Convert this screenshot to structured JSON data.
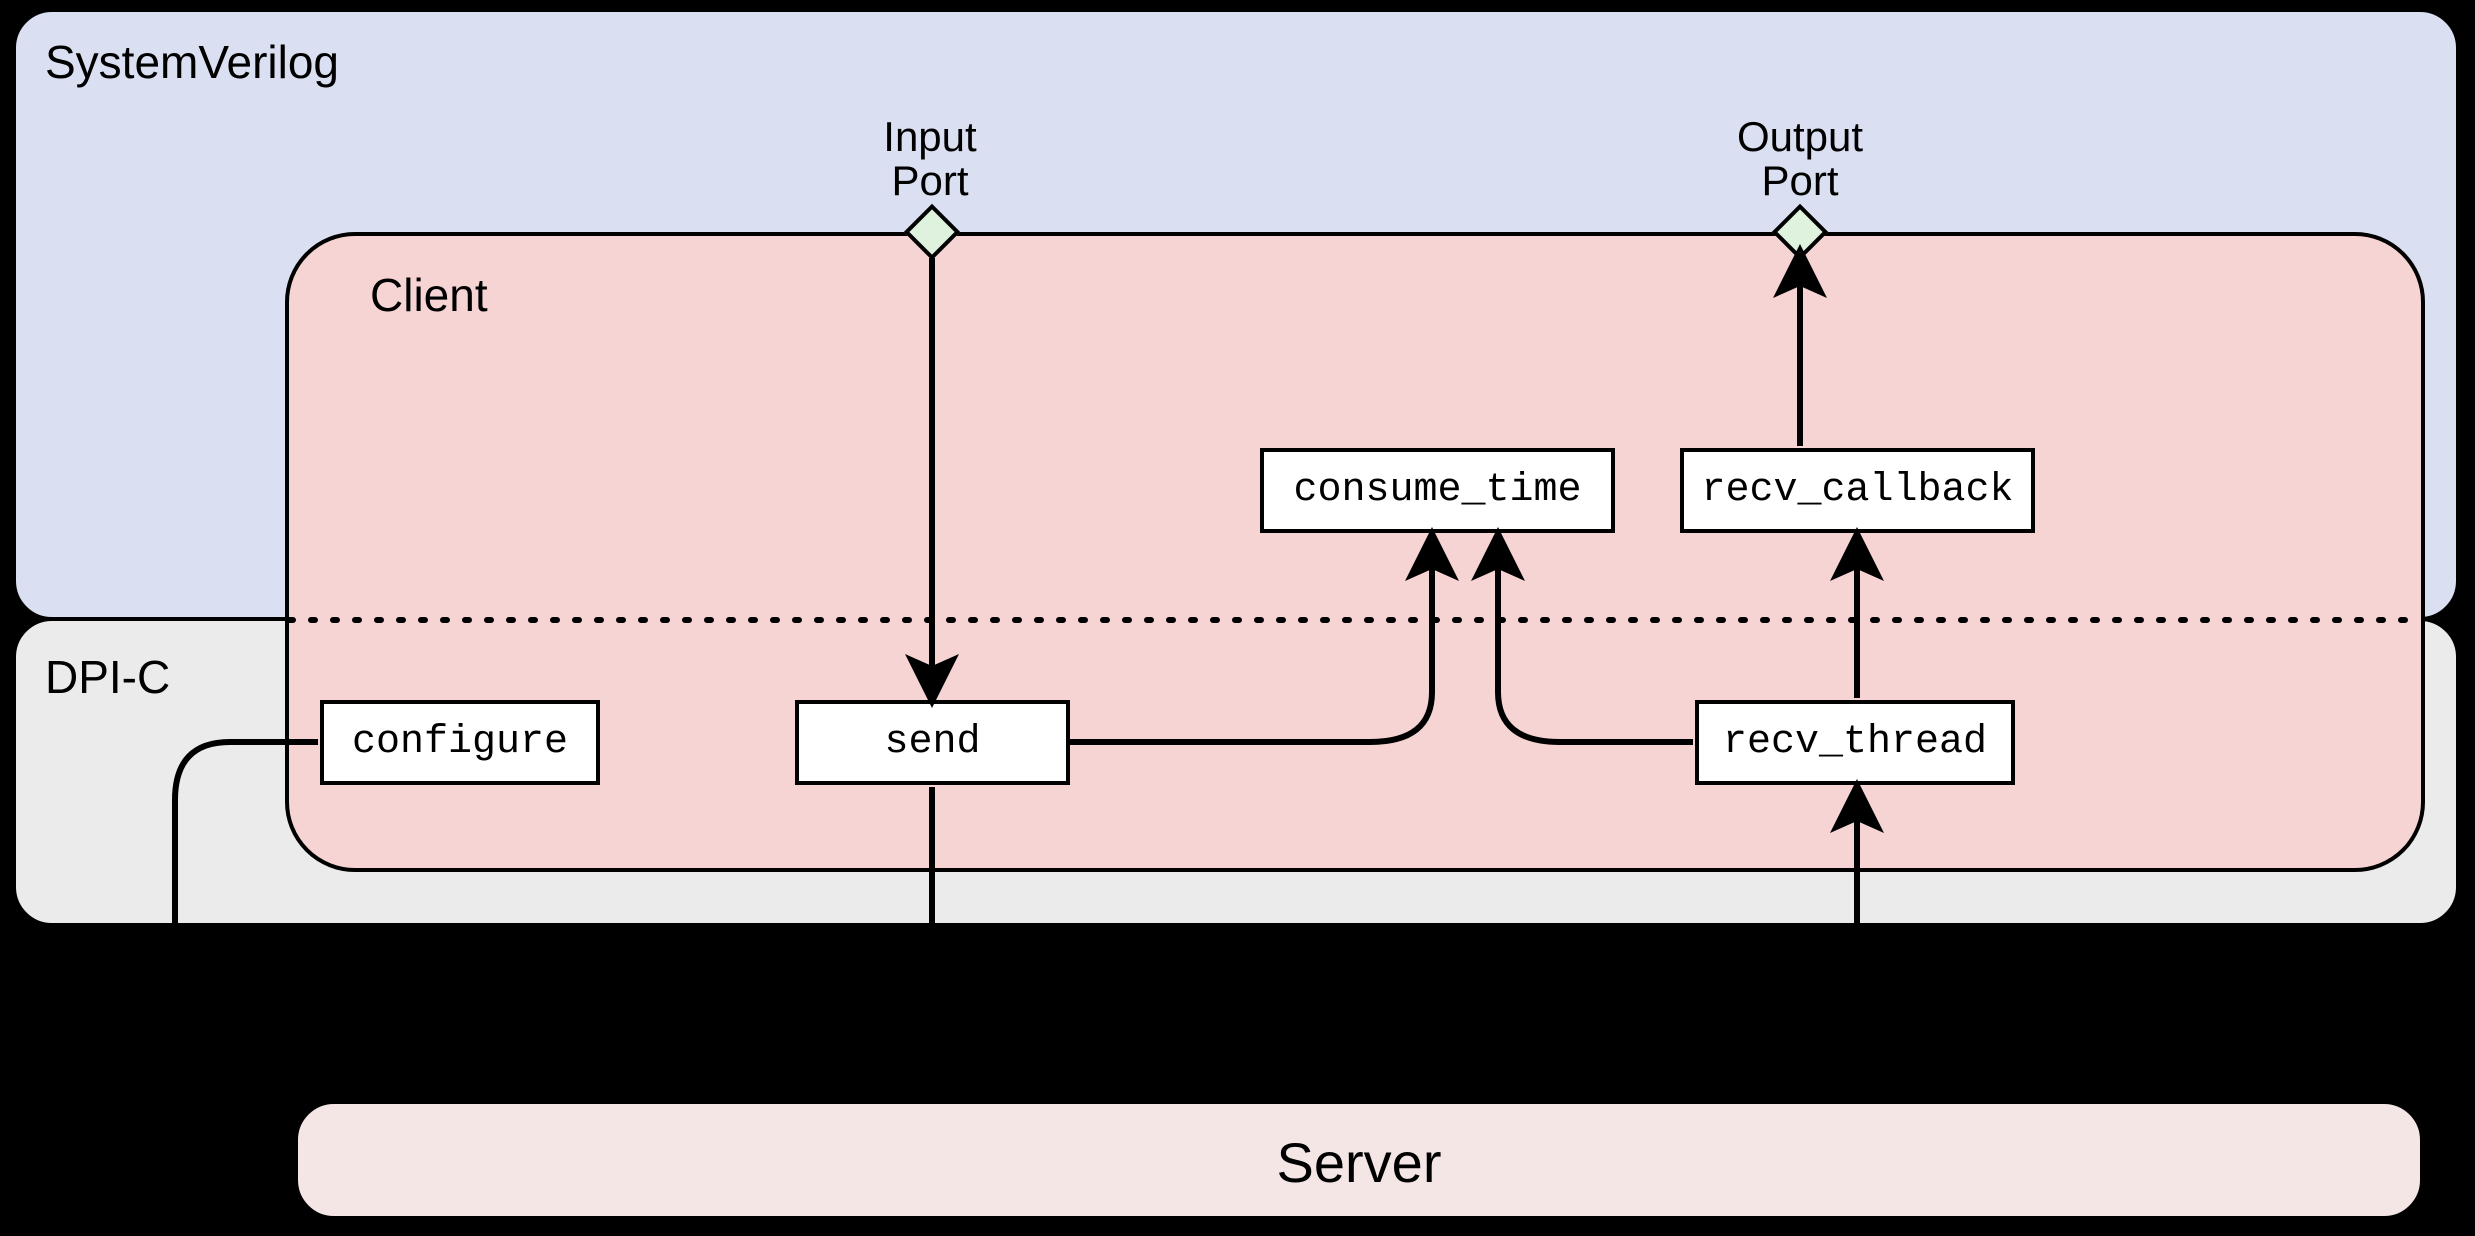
{
  "regions": {
    "systemverilog": "SystemVerilog",
    "dpic": "DPI-C",
    "client": "Client",
    "server": "Server"
  },
  "ports": {
    "input": "Input\nPort",
    "output": "Output\nPort"
  },
  "nodes": {
    "configure": "configure",
    "send": "send",
    "consume_time": "consume_time",
    "recv_callback": "recv_callback",
    "recv_thread": "recv_thread"
  }
}
